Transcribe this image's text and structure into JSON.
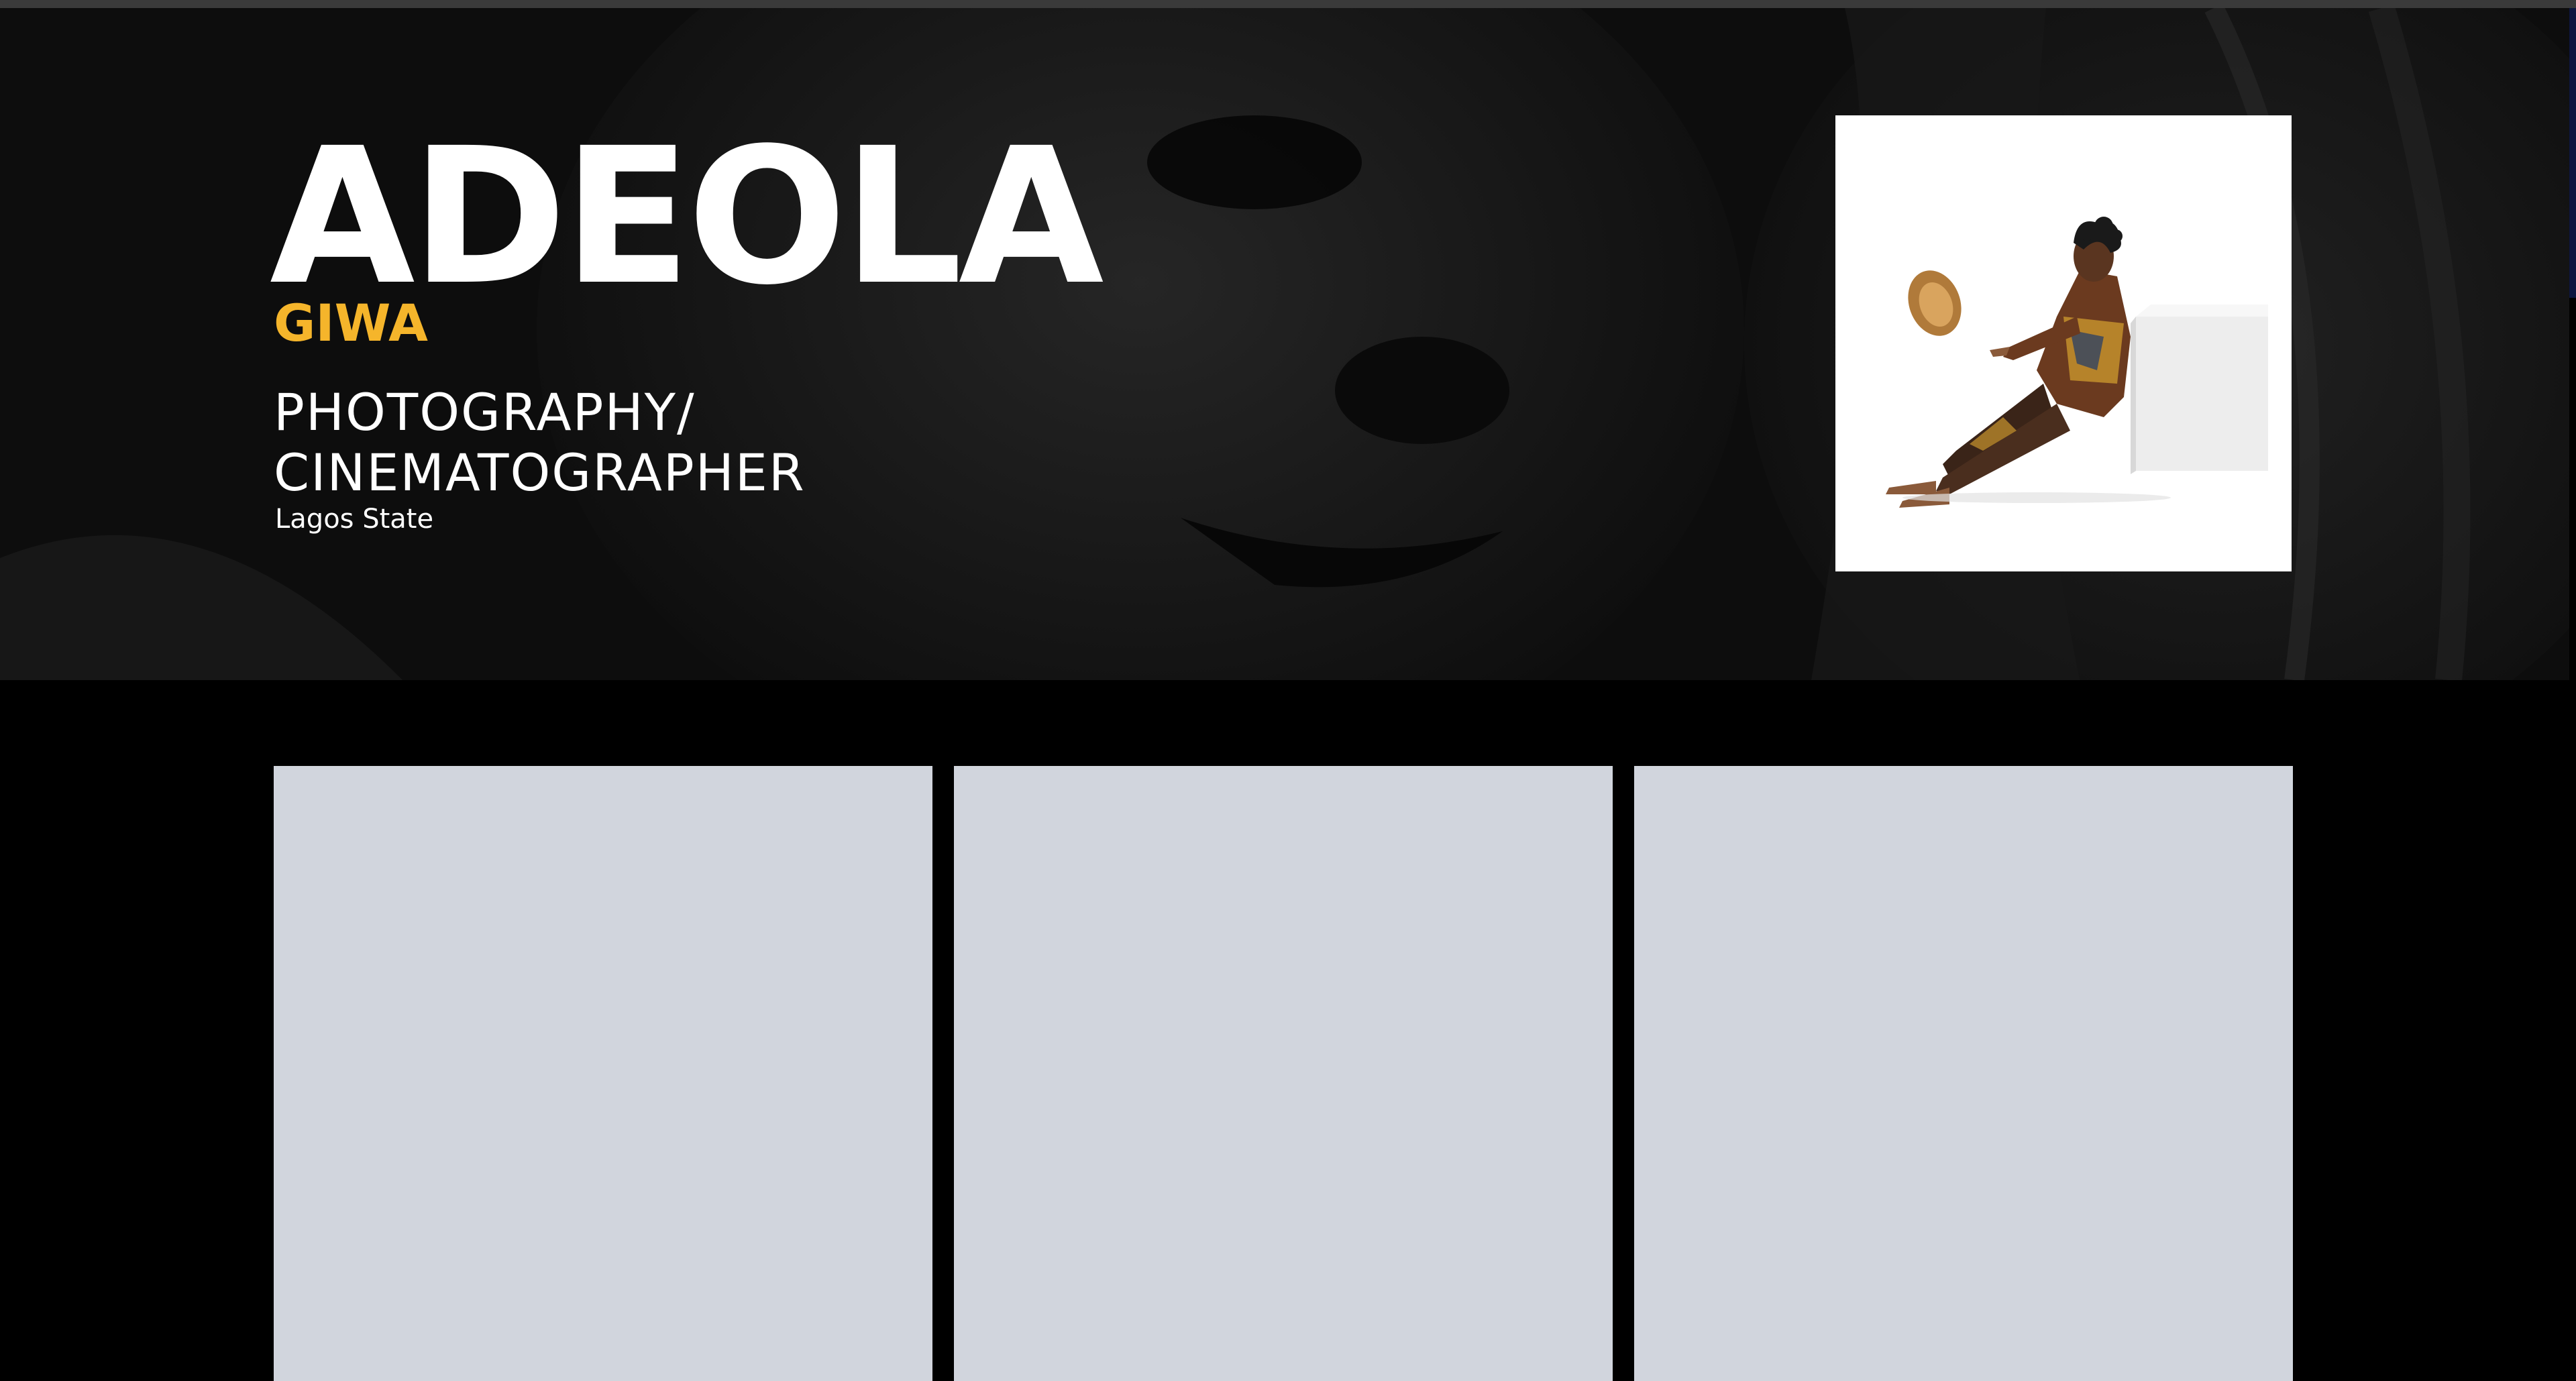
{
  "hero": {
    "first_name": "ADEOLA",
    "last_name": "GIWA",
    "role_line1": "PHOTOGRAPHY/",
    "role_line2": "CINEMATOGRAPHER",
    "location": "Lagos State"
  },
  "portrait": {
    "icon": "portrait-photo-icon"
  },
  "gallery": {
    "items": [
      {
        "icon": "gallery-image-placeholder"
      },
      {
        "icon": "gallery-image-placeholder"
      },
      {
        "icon": "gallery-image-placeholder"
      }
    ]
  },
  "colors": {
    "accent": "#f5b52b",
    "background": "#000000",
    "placeholder": "#d1d5dd",
    "scroll_thumb": "#0d1640"
  }
}
